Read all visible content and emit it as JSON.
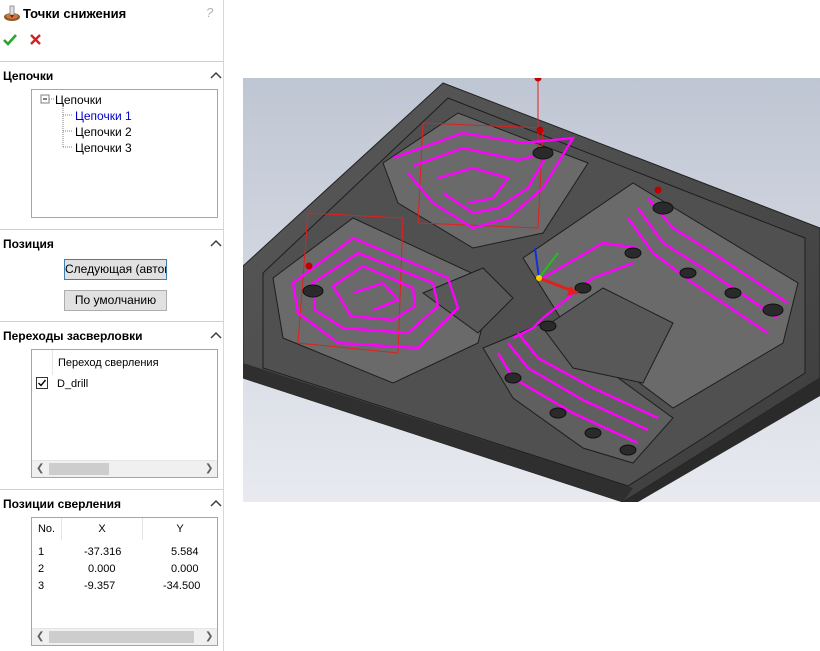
{
  "window": {
    "title": "Точки снижения",
    "help": "?"
  },
  "actions": {
    "ok": "ok-check",
    "cancel": "cancel-x"
  },
  "chains": {
    "header": "Цепочки",
    "root": "Цепочки",
    "items": [
      "Цепочки 1",
      "Цепочки 2",
      "Цепочки 3"
    ]
  },
  "position": {
    "header": "Позиция",
    "next_button": "Следующая (автом.)",
    "default_button": "По умолчанию"
  },
  "drill_transitions": {
    "header": "Переходы засверловки",
    "column": "Переход сверления",
    "items": [
      {
        "label": "D_drill",
        "checked": true
      }
    ]
  },
  "drill_positions": {
    "header": "Позиции сверления",
    "columns": [
      "No.",
      "X",
      "Y"
    ],
    "rows": [
      [
        "1",
        "-37.316",
        "5.584"
      ],
      [
        "2",
        "0.000",
        "0.000"
      ],
      [
        "3",
        "-9.357",
        "-34.500"
      ]
    ]
  },
  "viewport": {
    "toolpath_color": "#ff00ff",
    "highlight_color": "#0000cc"
  }
}
